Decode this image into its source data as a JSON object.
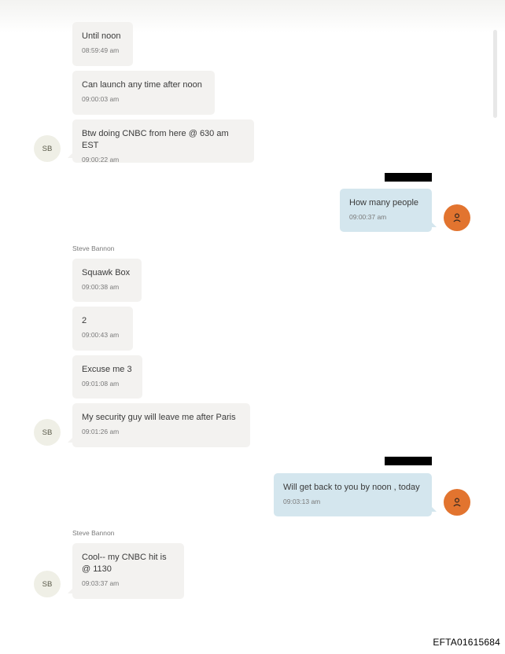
{
  "sender": {
    "name": "Steve Bannon",
    "initials": "SB"
  },
  "messages": [
    {
      "text": "Until noon",
      "time": "08:59:49 am"
    },
    {
      "text": "Can launch any time after noon",
      "time": "09:00:03 am"
    },
    {
      "text": "Btw doing CNBC from here @ 630 am EST",
      "time": "09:00:22 am"
    },
    {
      "text": "How many people",
      "time": "09:00:37 am"
    },
    {
      "text": "Squawk Box",
      "time": "09:00:38 am"
    },
    {
      "text": "2",
      "time": "09:00:43 am"
    },
    {
      "text": "Excuse me 3",
      "time": "09:01:08 am"
    },
    {
      "text": "My security guy will leave me after Paris",
      "time": "09:01:26 am"
    },
    {
      "text": "Will get back to you by noon , today",
      "time": "09:03:13 am"
    },
    {
      "text": "Cool-- my CNBC hit is @ 1130",
      "time": "09:03:37 am"
    }
  ],
  "footer": {
    "doc_id": "EFTA01615684"
  },
  "colors": {
    "incoming_bubble": "#f3f2f0",
    "outgoing_bubble": "#d4e6ee",
    "own_avatar": "#e2742f",
    "sender_avatar": "#efefe6"
  }
}
